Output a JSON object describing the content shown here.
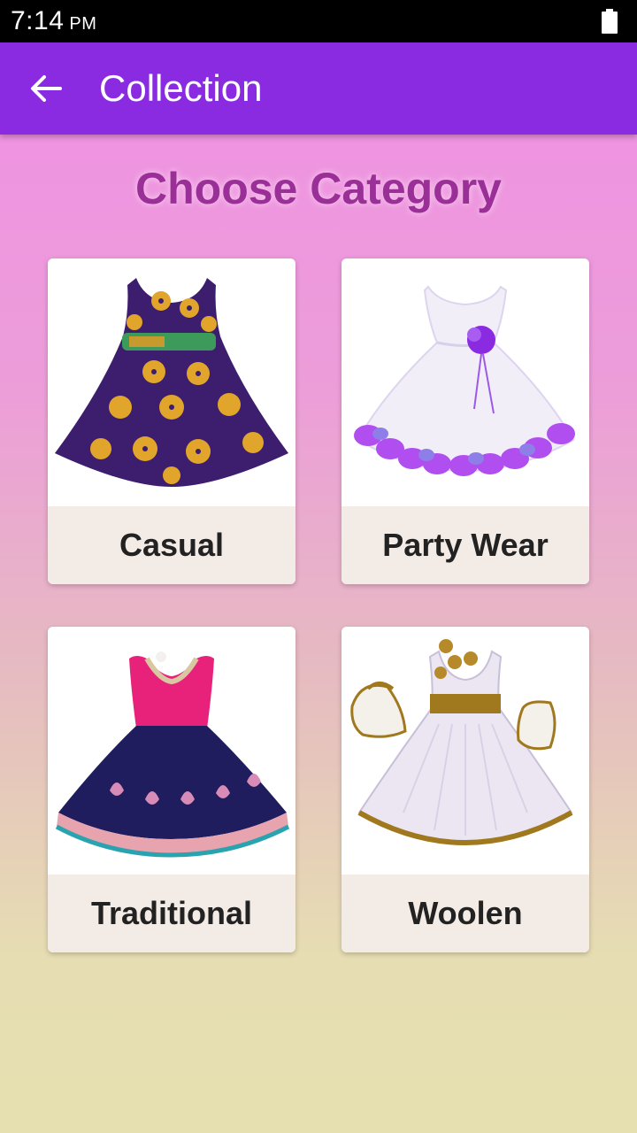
{
  "status_bar": {
    "time": "7:14",
    "ampm": "PM"
  },
  "app_bar": {
    "title": "Collection",
    "back_icon": "arrow-left-icon"
  },
  "heading": "Choose Category",
  "categories": [
    {
      "label": "Casual"
    },
    {
      "label": "Party Wear"
    },
    {
      "label": "Traditional"
    },
    {
      "label": "Woolen"
    }
  ],
  "colors": {
    "app_bar": "#8a2be2",
    "heading": "#9b2f98",
    "label_bg": "#f3ebe6",
    "bg_top": "#f08ee6",
    "bg_bottom": "#e6e0b0"
  }
}
